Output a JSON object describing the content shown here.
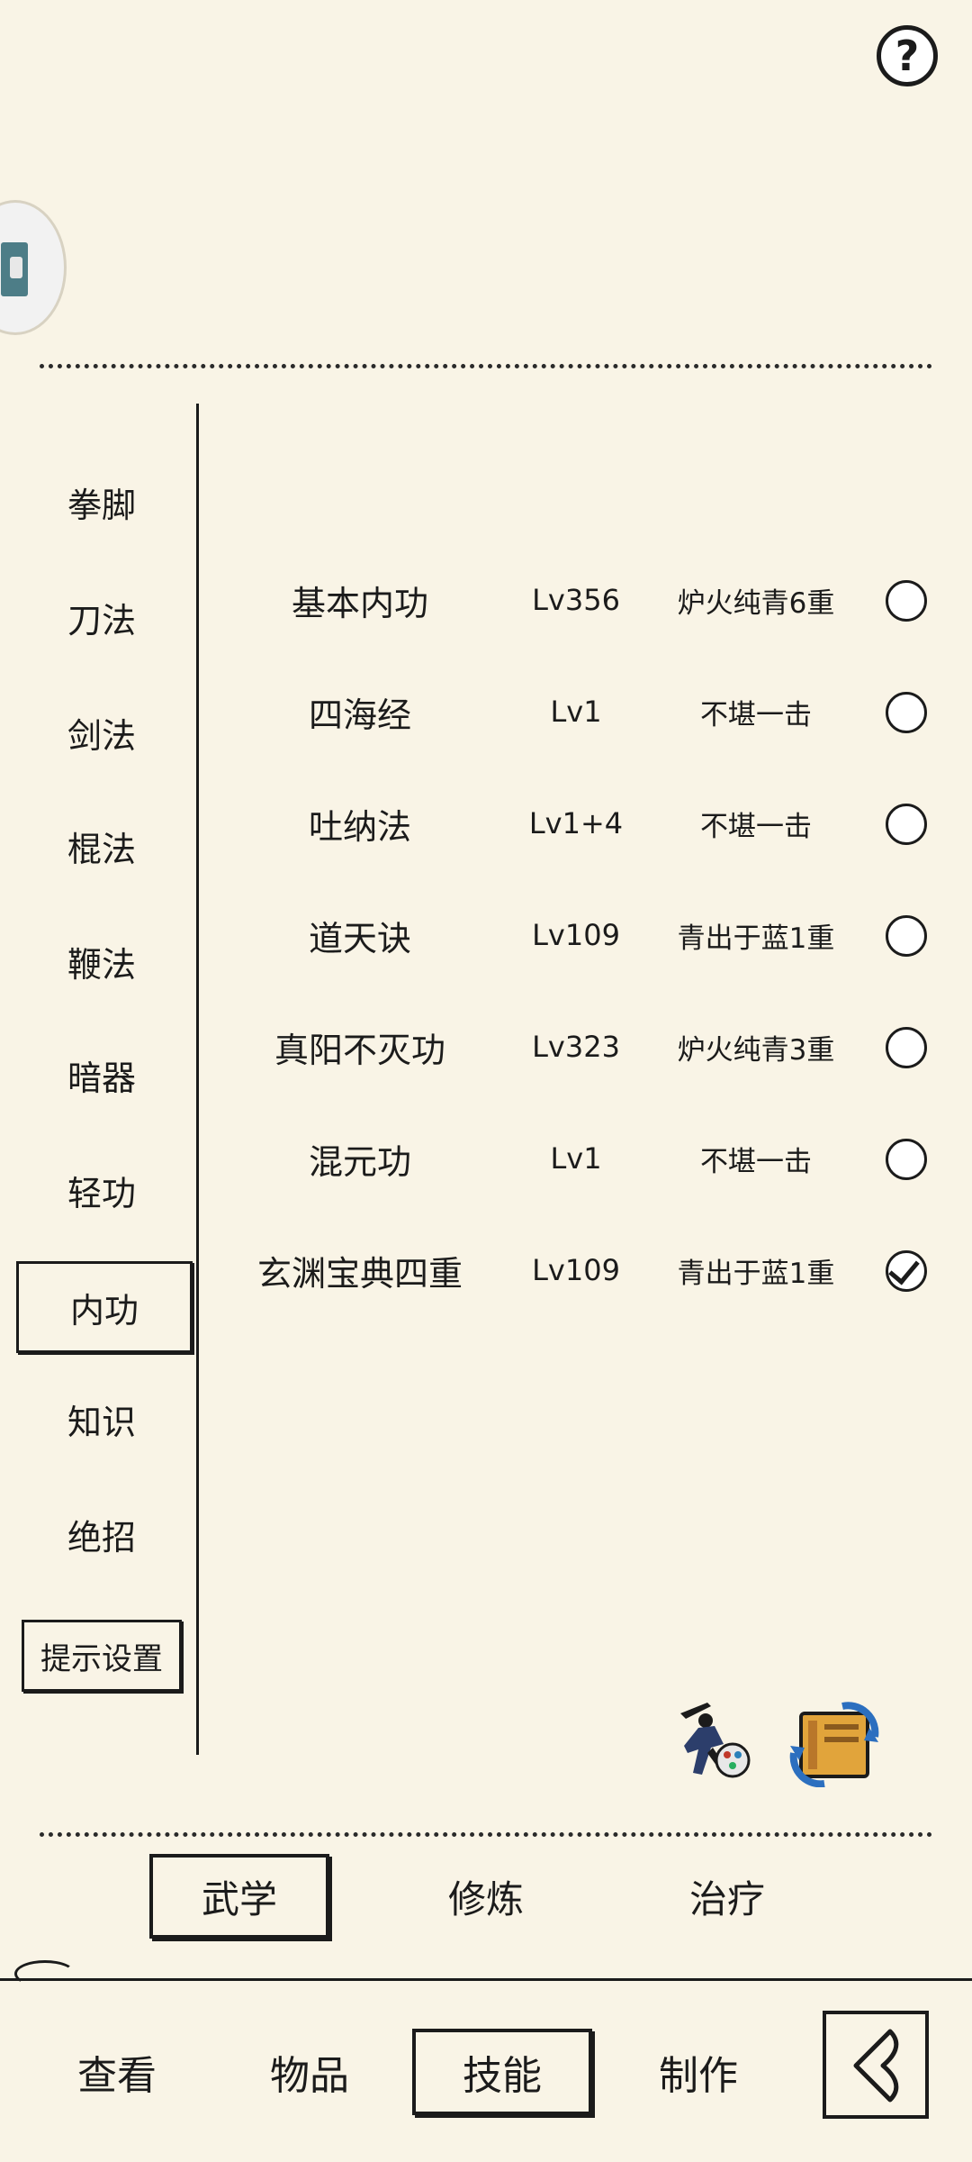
{
  "header": {
    "help_icon": "question-mark-icon",
    "help_label": "?"
  },
  "categories": [
    {
      "label": "拳脚"
    },
    {
      "label": "刀法"
    },
    {
      "label": "剑法"
    },
    {
      "label": "棍法"
    },
    {
      "label": "鞭法"
    },
    {
      "label": "暗器"
    },
    {
      "label": "轻功"
    },
    {
      "label": "内功",
      "active": true
    },
    {
      "label": "知识"
    },
    {
      "label": "绝招"
    }
  ],
  "hint_settings_label": "提示设置",
  "skills": [
    {
      "name": "基本内功",
      "level": "Lv356",
      "rank": "炉火纯青6重",
      "selected": false
    },
    {
      "name": "四海经",
      "level": "Lv1",
      "rank": "不堪一击",
      "selected": false
    },
    {
      "name": "吐纳法",
      "level": "Lv1+4",
      "rank": "不堪一击",
      "selected": false
    },
    {
      "name": "道天诀",
      "level": "Lv109",
      "rank": "青出于蓝1重",
      "selected": false
    },
    {
      "name": "真阳不灭功",
      "level": "Lv323",
      "rank": "炉火纯青3重",
      "selected": false
    },
    {
      "name": "混元功",
      "level": "Lv1",
      "rank": "不堪一击",
      "selected": false
    },
    {
      "name": "玄渊宝典四重",
      "level": "Lv109",
      "rank": "青出于蓝1重",
      "selected": true
    }
  ],
  "subtabs": [
    {
      "label": "武学",
      "active": true
    },
    {
      "label": "修炼",
      "active": false
    },
    {
      "label": "治疗",
      "active": false
    }
  ],
  "bottom_nav": [
    {
      "label": "查看",
      "active": false
    },
    {
      "label": "物品",
      "active": false
    },
    {
      "label": "技能",
      "active": true
    },
    {
      "label": "制作",
      "active": false
    }
  ],
  "icons": {
    "warrior": "martial-artist-icon",
    "book": "skill-book-swap-icon",
    "back": "back-arrow-icon"
  }
}
